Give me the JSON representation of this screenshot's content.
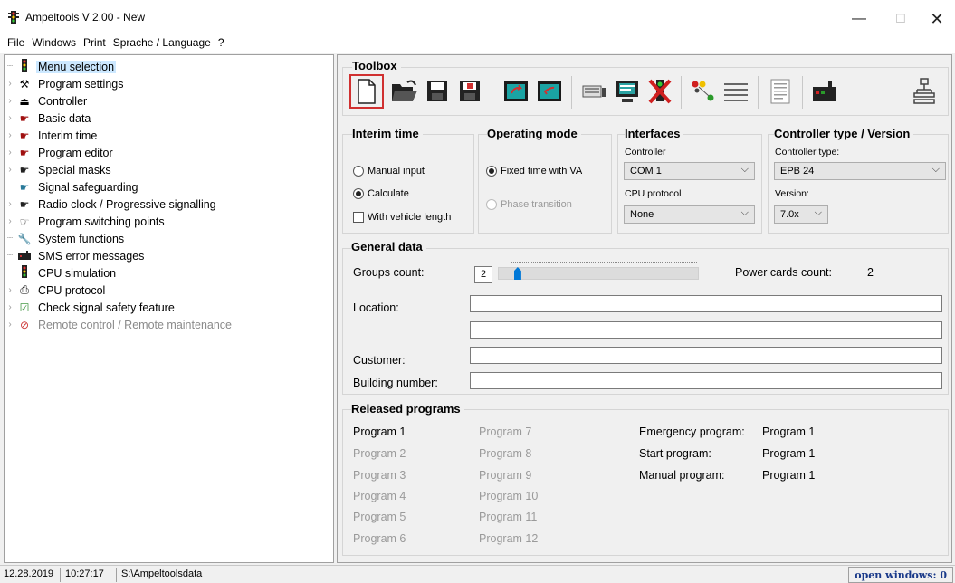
{
  "window": {
    "title": "Ampeltools V 2.00 - New",
    "app_icon": "traffic-light-icon"
  },
  "menu": [
    "File",
    "Windows",
    "Print",
    "Sprache / Language",
    "?"
  ],
  "tree": [
    {
      "label": "Menu selection",
      "icon": "traffic-light-icon",
      "selected": true
    },
    {
      "label": "Program settings",
      "icon": "tools-icon"
    },
    {
      "label": "Controller",
      "icon": "controller-icon"
    },
    {
      "label": "Basic data",
      "icon": "hand-icon"
    },
    {
      "label": "Interim time",
      "icon": "hand-icon"
    },
    {
      "label": "Program editor",
      "icon": "hand-icon"
    },
    {
      "label": "Special masks",
      "icon": "hand-icon"
    },
    {
      "label": "Signal safeguarding",
      "icon": "hand-icon"
    },
    {
      "label": "Radio clock / Progressive signalling",
      "icon": "hand-icon"
    },
    {
      "label": "Program switching points",
      "icon": "hand-icon"
    },
    {
      "label": "System functions",
      "icon": "wrench-icon"
    },
    {
      "label": "SMS error messages",
      "icon": "phone-icon"
    },
    {
      "label": "CPU simulation",
      "icon": "traffic-light-icon"
    },
    {
      "label": "CPU protocol",
      "icon": "printer-icon"
    },
    {
      "label": "Check signal safety feature",
      "icon": "check-doc-icon"
    },
    {
      "label": "Remote control / Remote maintenance",
      "icon": "forbidden-icon",
      "disabled": true
    }
  ],
  "toolbox": {
    "title": "Toolbox",
    "buttons": [
      "new-file-icon",
      "open-folder-icon",
      "save-icon",
      "save-as-icon",
      "export-icon",
      "import-icon",
      "keyboard-icon",
      "monitor-icon",
      "delete-icon",
      "signal-groups-icon",
      "list-icon",
      "document-icon",
      "controller-box-icon",
      "network-icon"
    ]
  },
  "interim_time": {
    "title": "Interim time",
    "manual": "Manual input",
    "calculate": "Calculate",
    "vehicle_length": "With vehicle length"
  },
  "operating_mode": {
    "title": "Operating mode",
    "fixed_time": "Fixed time with VA",
    "phase_transition": "Phase transition"
  },
  "interfaces": {
    "title": "Interfaces",
    "controller_label": "Controller",
    "controller_value": "COM 1",
    "cpu_label": "CPU protocol",
    "cpu_value": "None"
  },
  "controller_type": {
    "title": "Controller type / Version",
    "type_label": "Controller type:",
    "type_value": "EPB 24",
    "version_label": "Version:",
    "version_value": "7.0x"
  },
  "general": {
    "title": "General data",
    "groups_label": "Groups count:",
    "groups_value": "2",
    "groups_slider_level": 0.05,
    "power_label": "Power cards count:",
    "power_value": "2",
    "location_label": "Location:",
    "customer_label": "Customer:",
    "building_label": "Building number:"
  },
  "released": {
    "title": "Released programs",
    "col1": [
      "Program 1",
      "Program 2",
      "Program 3",
      "Program 4",
      "Program 5",
      "Program 6"
    ],
    "col2": [
      "Program 7",
      "Program 8",
      "Program 9",
      "Program 10",
      "Program 11",
      "Program 12"
    ],
    "emergency_label": "Emergency program:",
    "emergency_value": "Program 1",
    "start_label": "Start program:",
    "start_value": "Program 1",
    "manual_label": "Manual program:",
    "manual_value": "Program 1"
  },
  "status": {
    "date": "12.28.2019",
    "time": "10:27:17",
    "path": "S:\\Ampeltoolsdata",
    "open_windows": "open windows: 0"
  },
  "colors": {
    "selection": "#cce8ff",
    "slider": "#0078d7",
    "status_accent": "#1a3a8a",
    "toolbox_active_border": "#d03030"
  }
}
